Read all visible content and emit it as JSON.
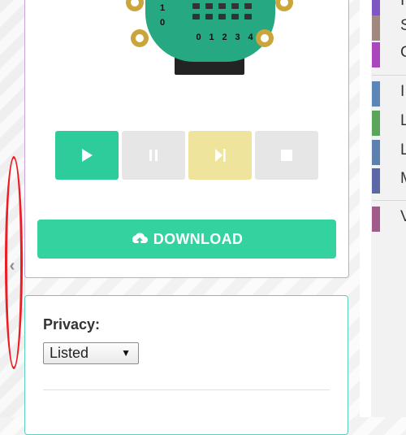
{
  "simulator": {
    "row_labels": [
      "1",
      "0"
    ],
    "column_labels": [
      "0",
      "1",
      "2",
      "3",
      "4"
    ],
    "controls": [
      "play",
      "pause",
      "step",
      "stop"
    ]
  },
  "download": {
    "label": "DOWNLOAD",
    "icon": "cloud-upload-icon"
  },
  "privacy": {
    "label": "Privacy:",
    "selected": "Listed",
    "arrow": "▼"
  },
  "toggle": {
    "glyph": "‹"
  },
  "categories": [
    {
      "letter": "I",
      "color": "#7e57c2"
    },
    {
      "letter": "S",
      "color": "#a1887f"
    },
    {
      "letter": "C",
      "color": "#ab47bc"
    },
    {
      "letter": "I",
      "color": "#5c86b5"
    },
    {
      "letter": "L",
      "color": "#5ba55a"
    },
    {
      "letter": "L",
      "color": "#5c80b0"
    },
    {
      "letter": "M",
      "color": "#5c67a8"
    },
    {
      "letter": "V",
      "color": "#a15b8a"
    }
  ],
  "colors": {
    "accent": "#33d29e",
    "annotation": "#ec1b24"
  }
}
